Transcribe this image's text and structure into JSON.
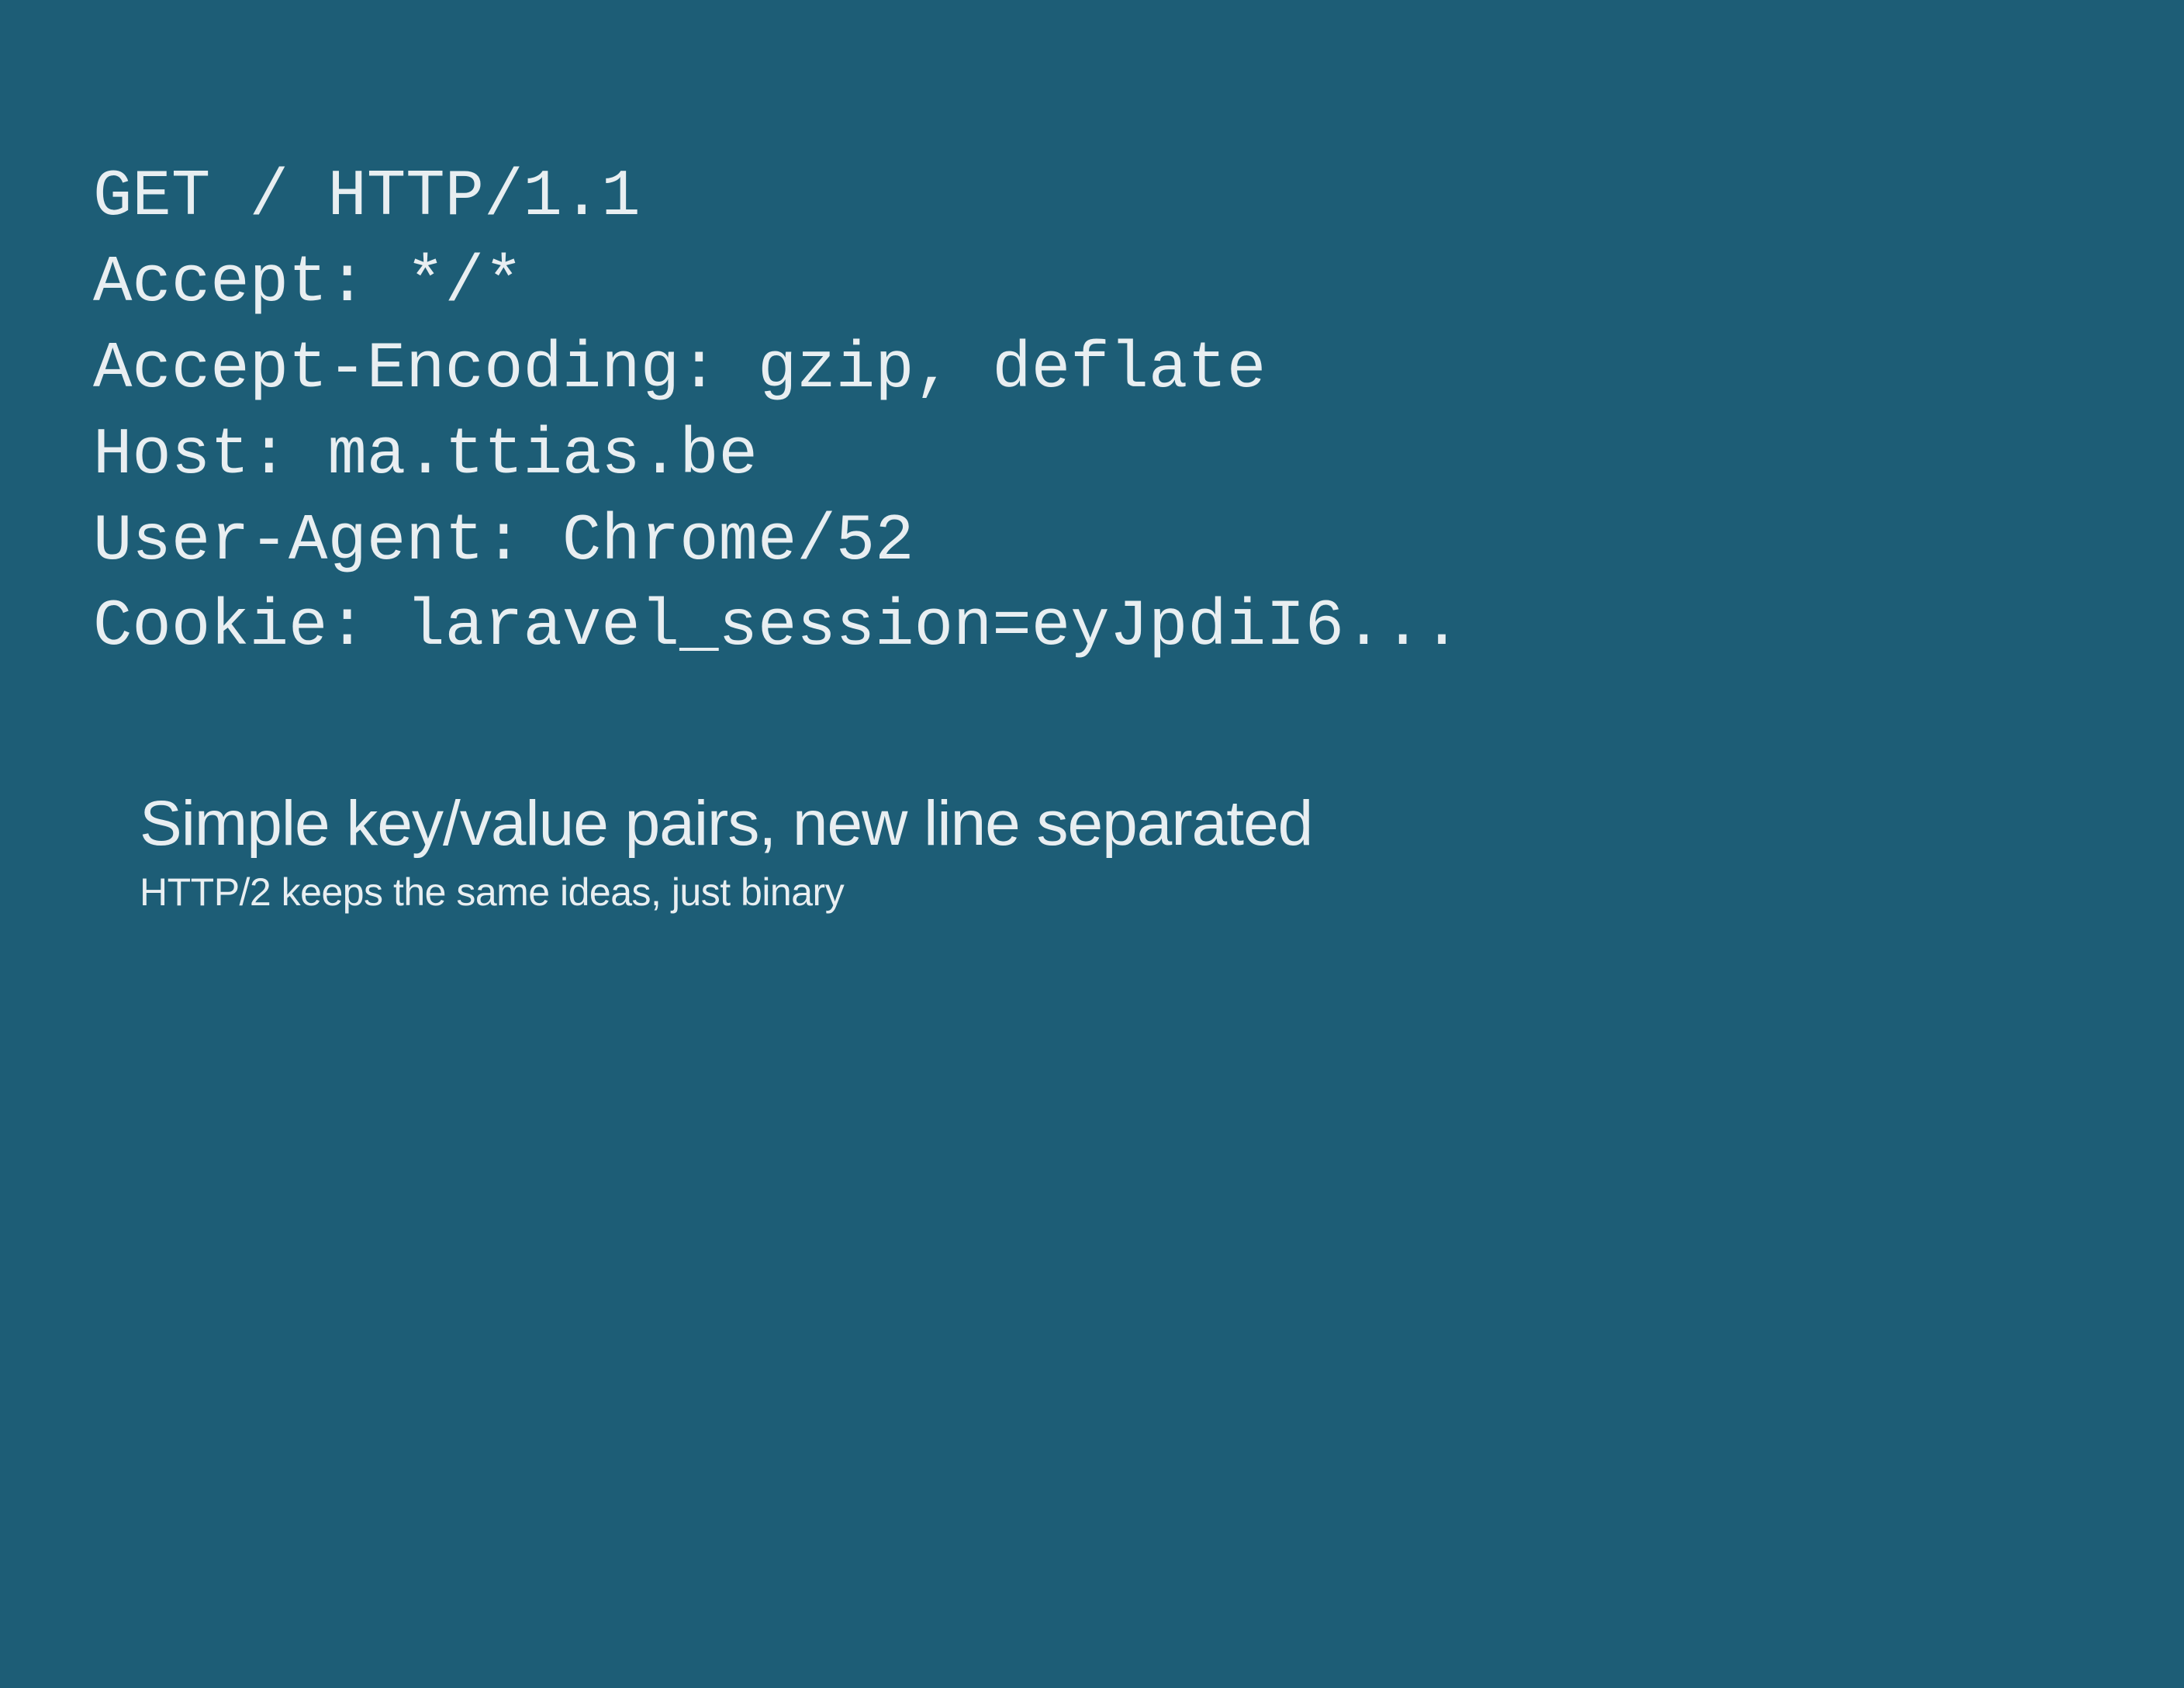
{
  "code": {
    "line1": "GET / HTTP/1.1",
    "line2": "Accept: */*",
    "line3": "Accept-Encoding: gzip, deflate",
    "line4": "Host: ma.ttias.be",
    "line5": "User-Agent: Chrome/52",
    "line6": "Cookie: laravel_session=eyJpdiI6..."
  },
  "caption": {
    "title": "Simple key/value pairs, new line separated",
    "subtitle": "HTTP/2 keeps the same ideas, just binary"
  }
}
